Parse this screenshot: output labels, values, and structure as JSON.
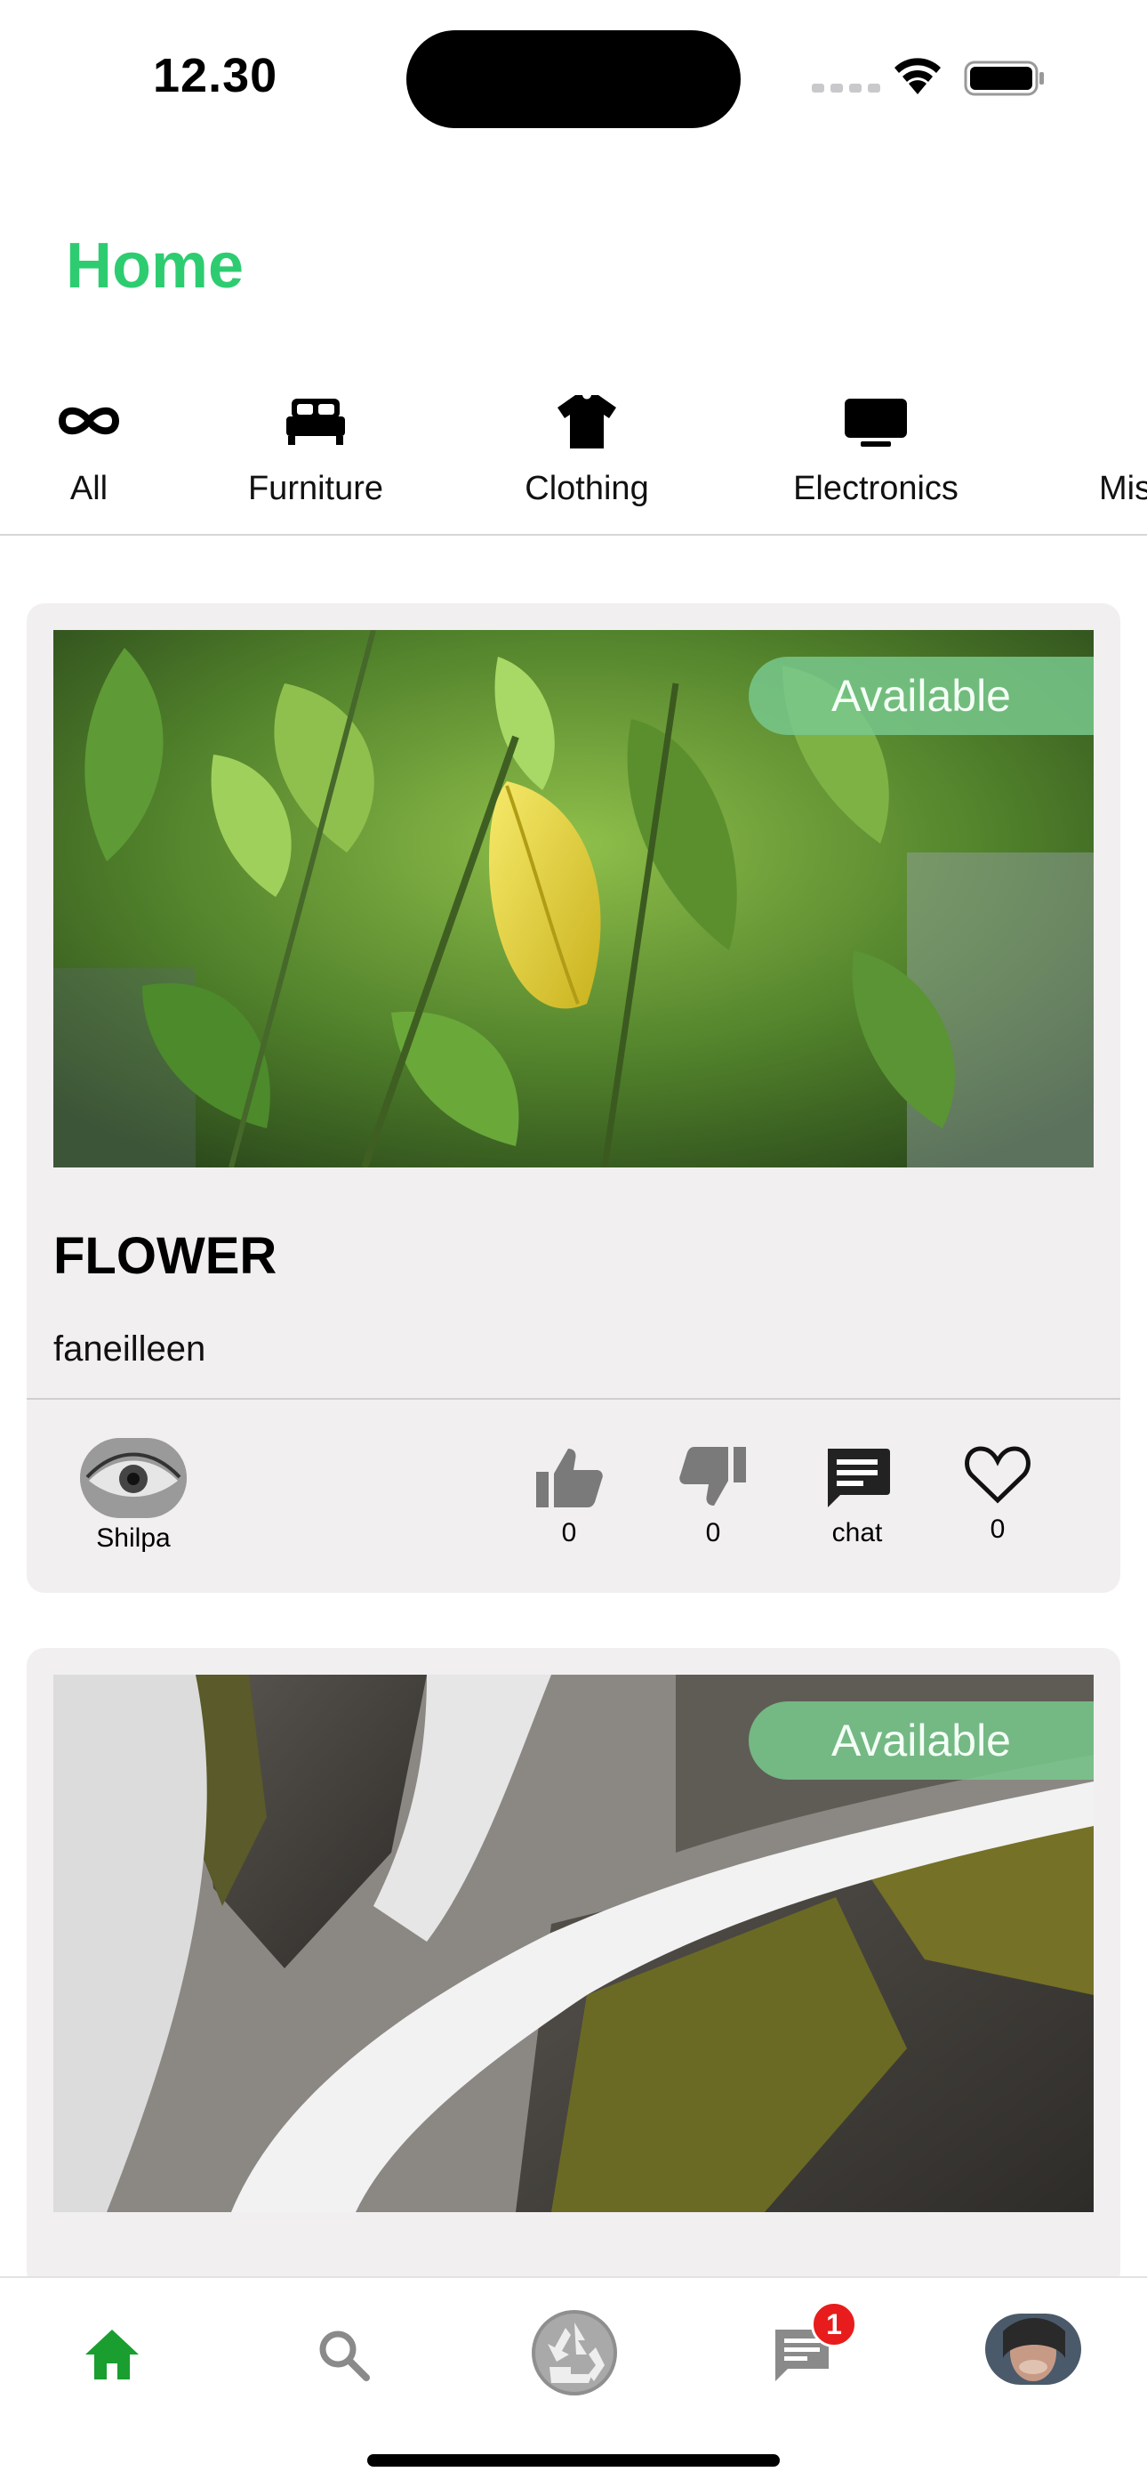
{
  "status_bar": {
    "time": "12.30"
  },
  "header": {
    "title": "Home"
  },
  "categories": [
    {
      "label": "All",
      "icon": "infinity-icon"
    },
    {
      "label": "Furniture",
      "icon": "bed-icon"
    },
    {
      "label": "Clothing",
      "icon": "tshirt-icon"
    },
    {
      "label": "Electronics",
      "icon": "tv-icon"
    },
    {
      "label": "Mis",
      "icon": "misc-icon"
    }
  ],
  "posts": [
    {
      "title": "FLOWER",
      "description": "faneilleen",
      "status": "Available",
      "owner": "Shilpa",
      "likes": "0",
      "dislikes": "0",
      "chat_label": "chat",
      "favorites": "0"
    },
    {
      "status": "Available"
    }
  ],
  "bottom_nav": {
    "items": [
      "home-icon",
      "search-icon",
      "recycle-icon",
      "chat-icon",
      "profile-avatar"
    ],
    "chat_badge": "1"
  },
  "colors": {
    "accent": "#2ecc71",
    "active_nav": "#1a9e2f",
    "inactive_nav": "#8a8a8a",
    "badge": "#e81c1c",
    "card_bg": "#f1eff0"
  }
}
